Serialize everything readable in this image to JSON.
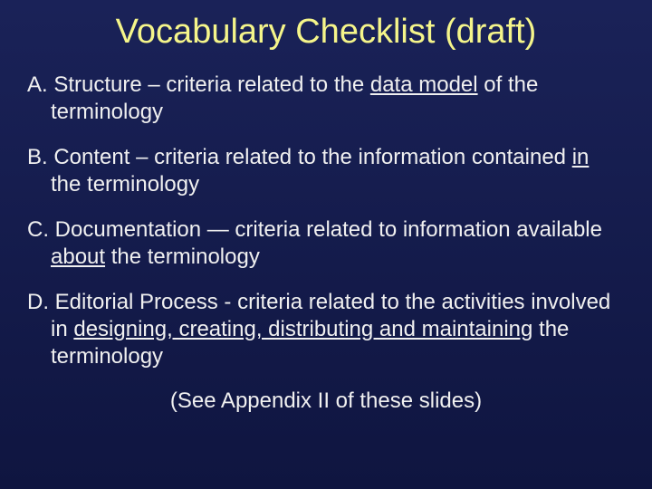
{
  "title": "Vocabulary Checklist (draft)",
  "items": {
    "a": {
      "label": "A. ",
      "pre": "Structure – criteria related to the ",
      "u": "data model",
      "post": " of the terminology"
    },
    "b": {
      "label": "B. ",
      "pre": "Content – criteria related to the information contained ",
      "u": "in",
      "post": " the terminology"
    },
    "c": {
      "label": "C. ",
      "pre": "Documentation — criteria related to information available ",
      "u": "about",
      "post": " the terminology"
    },
    "d": {
      "label": "D. ",
      "pre": "Editorial Process - criteria related to the activities involved in ",
      "u": "designing, creating, distributing and maintaining",
      "post": " the terminology"
    }
  },
  "footer": "(See Appendix II of these slides)"
}
